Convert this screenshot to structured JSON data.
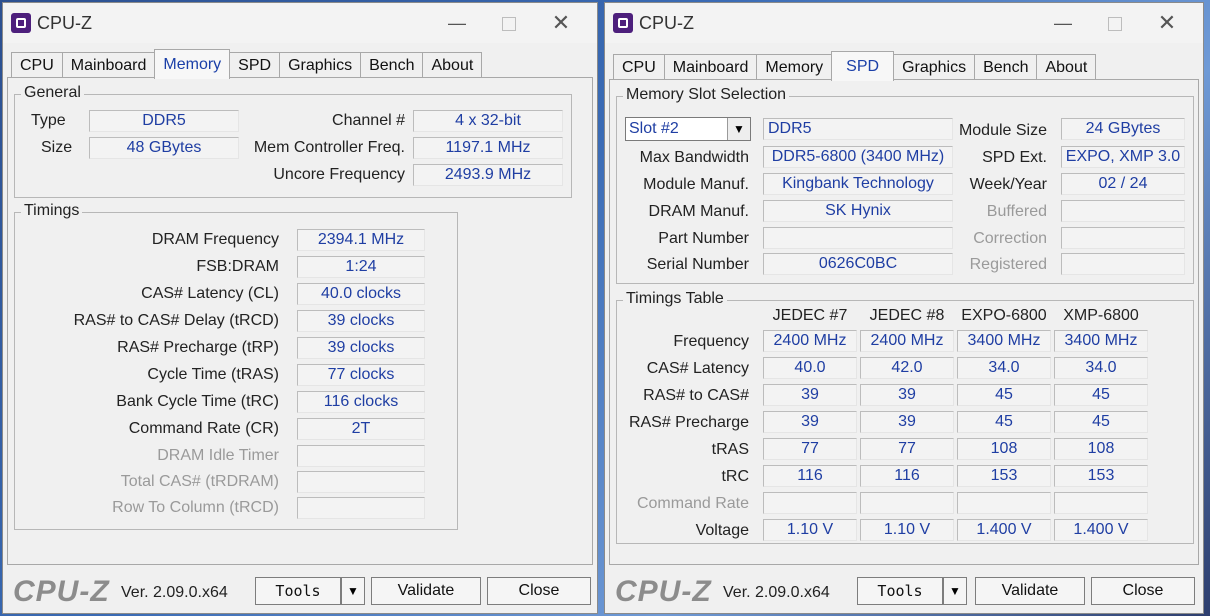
{
  "app_title": "CPU-Z",
  "tabs": [
    "CPU",
    "Mainboard",
    "Memory",
    "SPD",
    "Graphics",
    "Bench",
    "About"
  ],
  "footer": {
    "logo": "CPU-Z",
    "version": "Ver. 2.09.0.x64",
    "tools": "Tools",
    "validate": "Validate",
    "close": "Close"
  },
  "memory": {
    "general_label": "General",
    "type_label": "Type",
    "type_value": "DDR5",
    "size_label": "Size",
    "size_value": "48 GBytes",
    "channel_label": "Channel #",
    "channel_value": "4 x 32-bit",
    "mcf_label": "Mem Controller Freq.",
    "mcf_value": "1197.1 MHz",
    "uncore_label": "Uncore Frequency",
    "uncore_value": "2493.9 MHz",
    "timings_label": "Timings",
    "timings": [
      {
        "label": "DRAM Frequency",
        "value": "2394.1 MHz"
      },
      {
        "label": "FSB:DRAM",
        "value": "1:24"
      },
      {
        "label": "CAS# Latency (CL)",
        "value": "40.0 clocks"
      },
      {
        "label": "RAS# to CAS# Delay (tRCD)",
        "value": "39 clocks"
      },
      {
        "label": "RAS# Precharge (tRP)",
        "value": "39 clocks"
      },
      {
        "label": "Cycle Time (tRAS)",
        "value": "77 clocks"
      },
      {
        "label": "Bank Cycle Time (tRC)",
        "value": "116 clocks"
      },
      {
        "label": "Command Rate (CR)",
        "value": "2T"
      },
      {
        "label": "DRAM Idle Timer",
        "value": ""
      },
      {
        "label": "Total CAS# (tRDRAM)",
        "value": ""
      },
      {
        "label": "Row To Column (tRCD)",
        "value": ""
      }
    ]
  },
  "spd": {
    "slot_group_label": "Memory Slot Selection",
    "slot_value": "Slot #2",
    "ddr_value": "DDR5",
    "module_size_label": "Module Size",
    "module_size_value": "24 GBytes",
    "max_bw_label": "Max Bandwidth",
    "max_bw_value": "DDR5-6800 (3400 MHz)",
    "spd_ext_label": "SPD Ext.",
    "spd_ext_value": "EXPO, XMP 3.0",
    "module_manuf_label": "Module Manuf.",
    "module_manuf_value": "Kingbank Technology",
    "week_year_label": "Week/Year",
    "week_year_value": "02 / 24",
    "dram_manuf_label": "DRAM Manuf.",
    "dram_manuf_value": "SK Hynix",
    "buffered_label": "Buffered",
    "part_number_label": "Part Number",
    "part_number_value": "",
    "correction_label": "Correction",
    "serial_label": "Serial Number",
    "serial_value": "0626C0BC",
    "registered_label": "Registered",
    "timings_table_label": "Timings Table",
    "columns": [
      "JEDEC #7",
      "JEDEC #8",
      "EXPO-6800",
      "XMP-6800"
    ],
    "rows": [
      {
        "label": "Frequency",
        "values": [
          "2400 MHz",
          "2400 MHz",
          "3400 MHz",
          "3400 MHz"
        ]
      },
      {
        "label": "CAS# Latency",
        "values": [
          "40.0",
          "42.0",
          "34.0",
          "34.0"
        ]
      },
      {
        "label": "RAS# to CAS#",
        "values": [
          "39",
          "39",
          "45",
          "45"
        ]
      },
      {
        "label": "RAS# Precharge",
        "values": [
          "39",
          "39",
          "45",
          "45"
        ]
      },
      {
        "label": "tRAS",
        "values": [
          "77",
          "77",
          "108",
          "108"
        ]
      },
      {
        "label": "tRC",
        "values": [
          "116",
          "116",
          "153",
          "153"
        ]
      },
      {
        "label": "Command Rate",
        "values": [
          "",
          "",
          "",
          ""
        ]
      },
      {
        "label": "Voltage",
        "values": [
          "1.10 V",
          "1.10 V",
          "1.400 V",
          "1.400 V"
        ]
      }
    ]
  }
}
